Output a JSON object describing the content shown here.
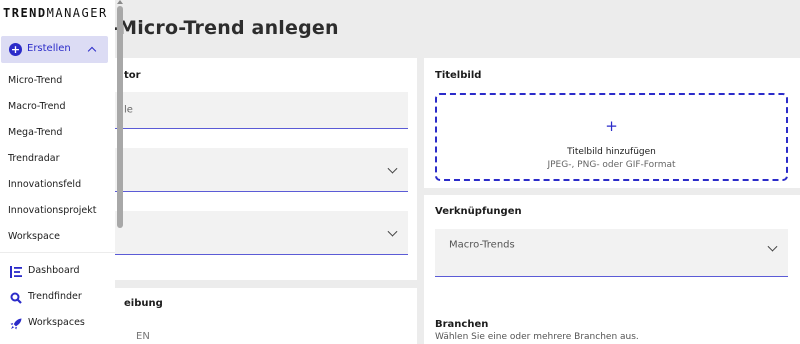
{
  "app": {
    "logo_bold": "TREND",
    "logo_light": "MANAGER"
  },
  "page": {
    "title": "-Micro-Trend anlegen"
  },
  "sidebar": {
    "create_label": "Erstellen",
    "create_items": [
      "Micro-Trend",
      "Macro-Trend",
      "Mega-Trend",
      "Trendradar",
      "Innovationsfeld",
      "Innovationsprojekt",
      "Workspace"
    ],
    "nav": [
      {
        "label": "Dashboard",
        "icon": "list-icon"
      },
      {
        "label": "Trendfinder",
        "icon": "search-icon"
      },
      {
        "label": "Workspaces",
        "icon": "rocket-icon"
      }
    ]
  },
  "left_card": {
    "section_label": "tor",
    "title_field_text": "le",
    "description_label": "eibung",
    "language_text": "EN"
  },
  "titelbild": {
    "label": "Titelbild",
    "upload_plus": "+",
    "upload_title": "Titelbild hinzufügen",
    "upload_hint": "JPEG-, PNG- oder GIF-Format"
  },
  "verknuepfungen": {
    "label": "Verknüpfungen",
    "macro_trends_placeholder": "Macro-Trends",
    "branchen_label": "Branchen",
    "branchen_hint": "Wählen Sie eine oder mehrere Branchen aus."
  },
  "colors": {
    "accent": "#2b2bc9",
    "accent_light": "#dcdcf4",
    "background": "#ececec"
  }
}
